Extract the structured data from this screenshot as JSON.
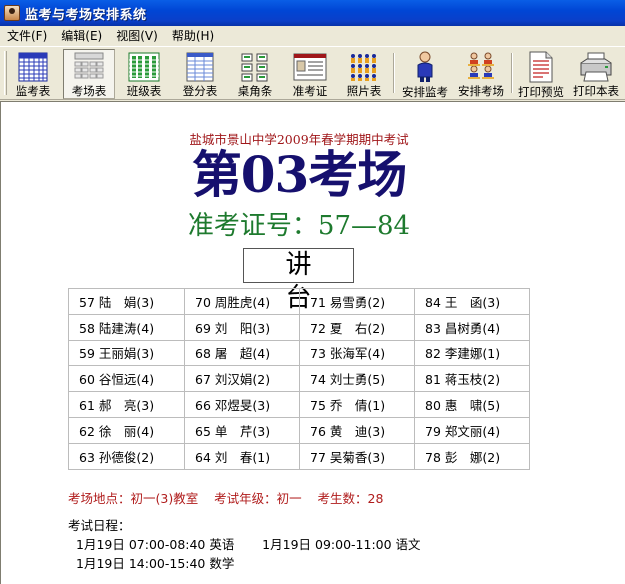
{
  "window": {
    "title": "监考与考场安排系统"
  },
  "menu": [
    {
      "label": "文件(F)"
    },
    {
      "label": "编辑(E)"
    },
    {
      "label": "视图(V)"
    },
    {
      "label": "帮助(H)"
    }
  ],
  "toolbar": [
    {
      "label": "监考表",
      "icon": "proctor-table-icon"
    },
    {
      "label": "考场表",
      "icon": "exam-room-table-icon",
      "pressed": true
    },
    {
      "label": "班级表",
      "icon": "class-table-icon"
    },
    {
      "label": "登分表",
      "icon": "score-table-icon"
    },
    {
      "label": "桌角条",
      "icon": "desk-label-icon"
    },
    {
      "label": "准考证",
      "icon": "admission-ticket-icon"
    },
    {
      "label": "照片表",
      "icon": "photo-table-icon"
    },
    {
      "label": "安排监考",
      "icon": "assign-proctor-icon"
    },
    {
      "label": "安排考场",
      "icon": "assign-room-icon"
    },
    {
      "label": "打印预览",
      "icon": "print-preview-icon"
    },
    {
      "label": "打印本表",
      "icon": "printer-icon"
    }
  ],
  "document": {
    "school_title": "盐城市景山中学2009年春学期期中考试",
    "room_title": "第03考场",
    "ticket_range": "准考证号：57—84",
    "podium": "讲台",
    "seats": [
      [
        "57 陆　娟(3)",
        "70 周胜虎(4)",
        "71 易雪勇(2)",
        "84 王　函(3)"
      ],
      [
        "58 陆建涛(4)",
        "69 刘　阳(3)",
        "72 夏　右(2)",
        "83 昌树勇(4)"
      ],
      [
        "59 王丽娟(3)",
        "68 屠　超(4)",
        "73 张海军(4)",
        "82 李建娜(1)"
      ],
      [
        "60 谷恒远(4)",
        "67 刘汉娟(2)",
        "74 刘士勇(5)",
        "81 蒋玉枝(2)"
      ],
      [
        "61 郝　亮(3)",
        "66 邓煜旻(3)",
        "75 乔　倩(1)",
        "80 惠　啸(5)"
      ],
      [
        "62 徐　丽(4)",
        "65 单　芹(3)",
        "76 黄　迪(3)",
        "79 郑文丽(4)"
      ],
      [
        "63 孙德俊(2)",
        "64 刘　春(1)",
        "77 吴菊香(3)",
        "78 彭　娜(2)"
      ]
    ],
    "summary": "考场地点：初一(3)教室    考试年级：初一    考生数：28",
    "schedule_title": "考试日程：",
    "schedule_line1": "1月19日 07:00-08:40 英语       1月19日 09:00-11:00 语文",
    "schedule_line2": "1月19日 14:00-15:40 数学"
  },
  "colors": {
    "title_bar": "#0046d5",
    "school_title": "#a0171a",
    "room_title": "#16106e",
    "ticket_range": "#1e7a2e",
    "summary": "#b01c1c"
  }
}
